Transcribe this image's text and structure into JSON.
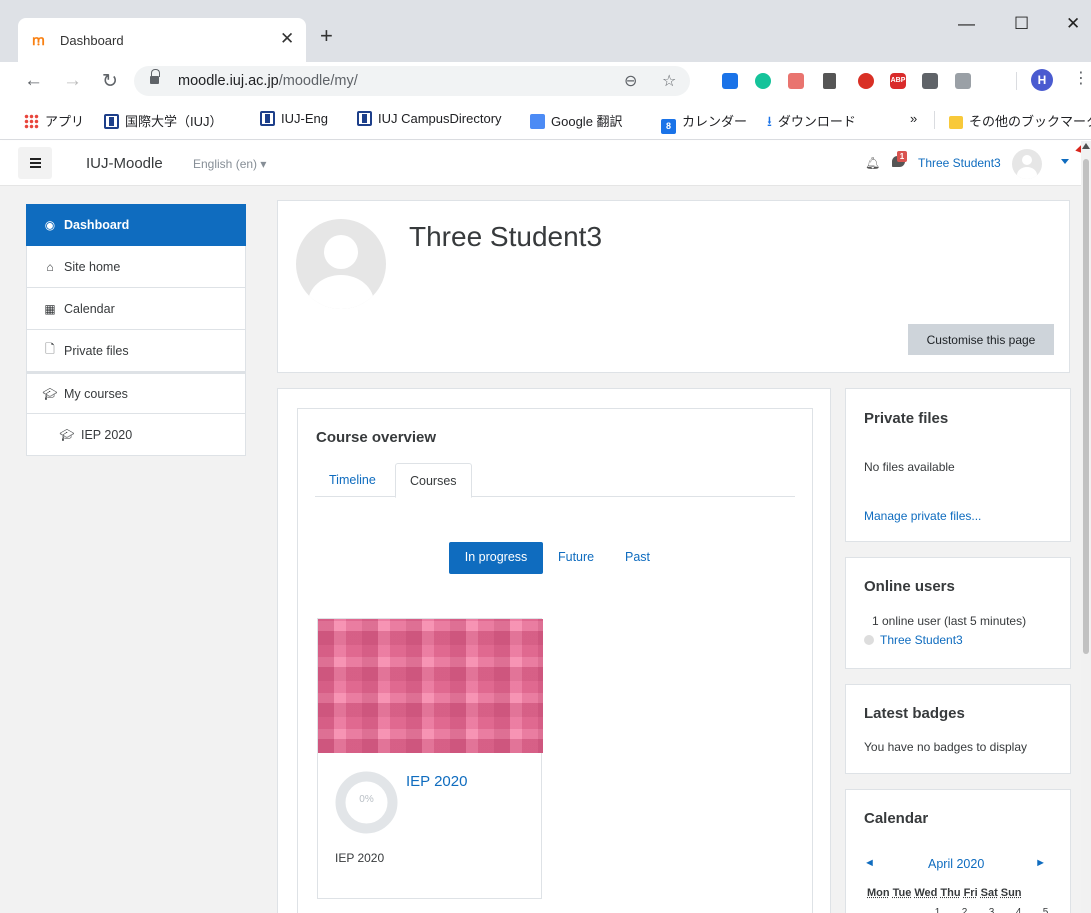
{
  "browser": {
    "tab_title": "Dashboard",
    "favicon_glyph": "ꭑ",
    "url_host": "moodle.iuj.ac.jp",
    "url_path": "/moodle/my/",
    "profile_initial": "H",
    "adblock_label": "ABP",
    "bookmarks": [
      {
        "label": "アプリ",
        "icon": "apps-grid-icon"
      },
      {
        "label": "国際大学（IUJ）",
        "icon": "iuj-icon"
      },
      {
        "label": "IUJ-Eng",
        "icon": "iuj-icon"
      },
      {
        "label": "IUJ CampusDirectory",
        "icon": "iuj-icon"
      },
      {
        "label": "Google 翻訳",
        "icon": "google-translate-icon"
      },
      {
        "label": "カレンダー",
        "icon": "calendar-icon"
      },
      {
        "label": "ダウンロード",
        "icon": "download-icon"
      }
    ],
    "bookmarks_overflow": "»",
    "other_bookmarks": "その他のブックマーク",
    "calendar_bookmark_day": "8"
  },
  "moodle": {
    "site_name": "IUJ-Moodle",
    "language": "English (en) ▾",
    "message_count": "1",
    "user_name": "Three Student3",
    "accent_color": "#0f6cbf"
  },
  "drawer": {
    "items": [
      {
        "label": "Dashboard",
        "icon": "dashboard-icon"
      },
      {
        "label": "Site home",
        "icon": "home-icon"
      },
      {
        "label": "Calendar",
        "icon": "calendar-icon"
      },
      {
        "label": "Private files",
        "icon": "file-icon"
      },
      {
        "label": "My courses",
        "icon": "graduation-cap-icon"
      },
      {
        "label": "IEP 2020",
        "icon": "graduation-cap-icon"
      }
    ]
  },
  "header": {
    "full_name": "Three Student3",
    "customise_button": "Customise this page"
  },
  "course_overview": {
    "title": "Course overview",
    "tabs": [
      "Timeline",
      "Courses"
    ],
    "filters": [
      "In progress",
      "Future",
      "Past"
    ],
    "course": {
      "name": "IEP 2020",
      "category": "IEP 2020",
      "progress_percent": 0,
      "progress_label": "0%"
    }
  },
  "blocks": {
    "private_files": {
      "title": "Private files",
      "empty": "No files available",
      "manage_link": "Manage private files..."
    },
    "online_users": {
      "title": "Online users",
      "summary": "1 online user (last 5 minutes)",
      "user": "Three Student3"
    },
    "latest_badges": {
      "title": "Latest badges",
      "empty": "You have no badges to display"
    },
    "calendar": {
      "title": "Calendar",
      "month": "April 2020",
      "prev": "◄",
      "next": "►",
      "days": [
        "Mon",
        "Tue",
        "Wed",
        "Thu",
        "Fri",
        "Sat",
        "Sun"
      ],
      "first_row": [
        "1",
        "2",
        "3",
        "4",
        "5"
      ]
    }
  }
}
